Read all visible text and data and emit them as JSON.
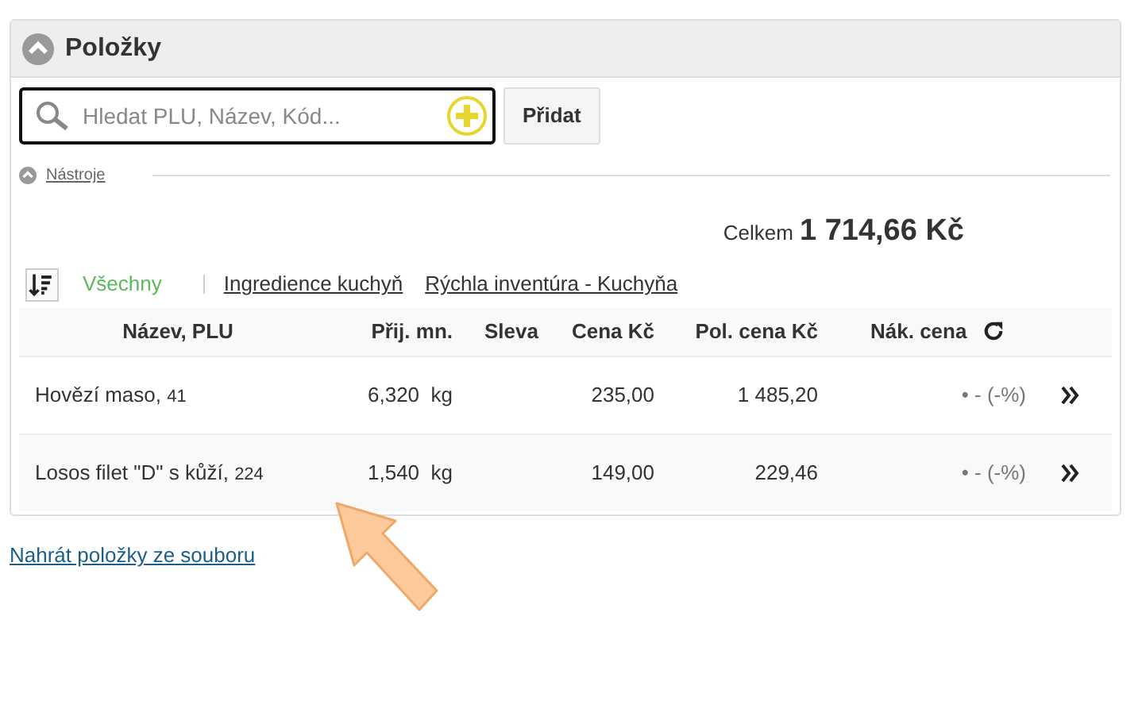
{
  "panel": {
    "title": "Položky",
    "expanded": true
  },
  "search": {
    "placeholder": "Hledat PLU, Název, Kód...",
    "button": "Přidat"
  },
  "tools": {
    "label": "Nástroje",
    "expanded": true
  },
  "total": {
    "label": "Celkem",
    "value": "1 714,66 Kč"
  },
  "filters": [
    {
      "label": "Všechny",
      "selected": true
    },
    {
      "label": "Ingredience kuchyň",
      "selected": false
    },
    {
      "label": "Rýchla inventúra - Kuchyňa",
      "selected": false
    }
  ],
  "table": {
    "columns": [
      "Název, PLU",
      "Přij. mn.",
      "Sleva",
      "Cena Kč",
      "Pol. cena Kč",
      "Nák. cena"
    ],
    "rows": [
      {
        "name": "Hovězí maso,",
        "plu": "41",
        "qty": "6,320",
        "unit": "kg",
        "price": "235,00",
        "total": "1 485,20",
        "purchase": "• - (-%)"
      },
      {
        "name": "Losos filet \"D\" s kůží,",
        "plu": "224",
        "qty": "1,540",
        "unit": "kg",
        "price": "149,00",
        "total": "229,46",
        "purchase": "• - (-%)"
      }
    ]
  },
  "upload_link": "Nahrát položky ze souboru"
}
